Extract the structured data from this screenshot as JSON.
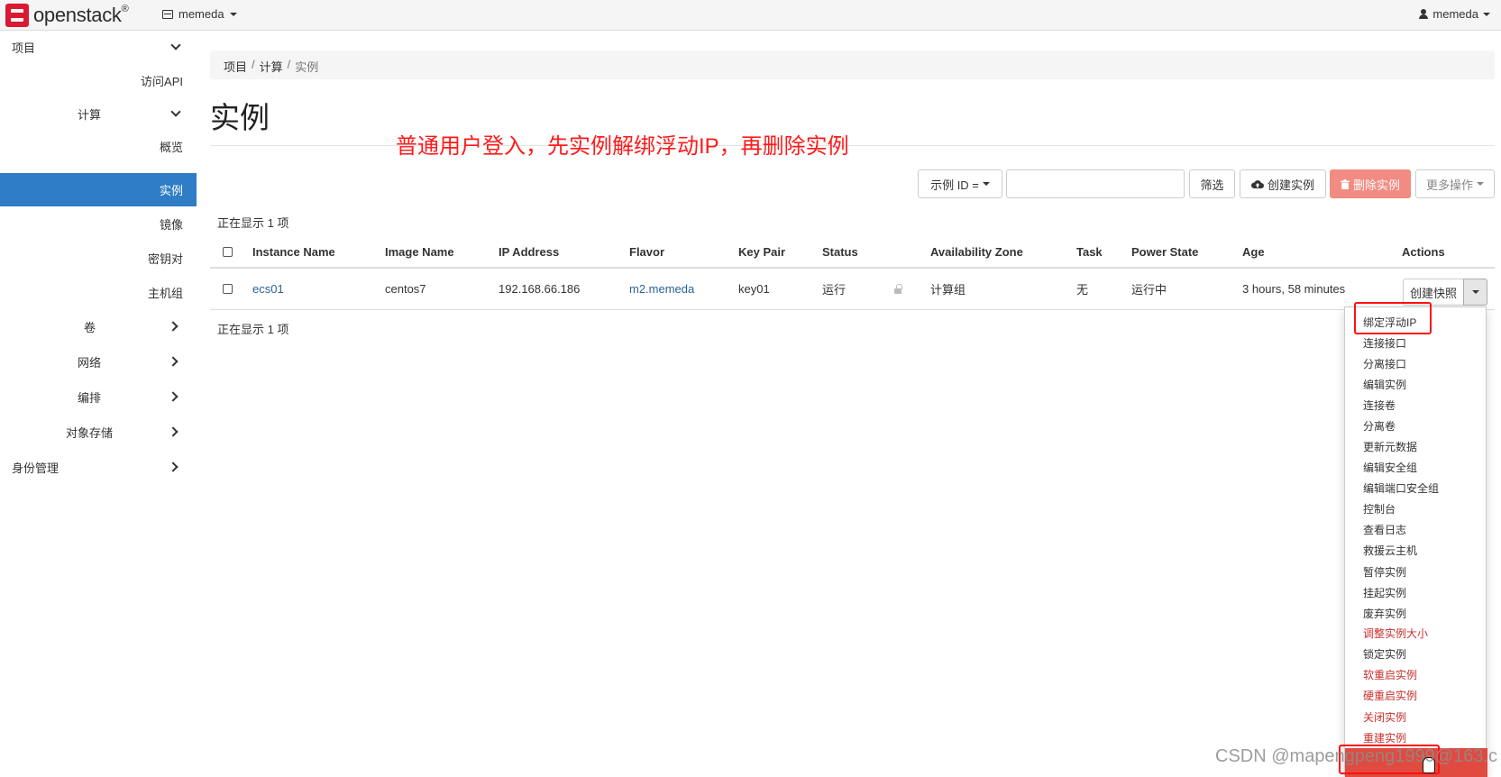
{
  "navbar": {
    "brand": "openstack",
    "brand_mark": "®",
    "project": "memeda",
    "user": "memeda"
  },
  "sidebar": {
    "items": [
      {
        "label": "项目"
      },
      {
        "label": "访问API"
      },
      {
        "label": "计算"
      },
      {
        "label": "概览"
      },
      {
        "label": "实例"
      },
      {
        "label": "镜像"
      },
      {
        "label": "密钥对"
      },
      {
        "label": "主机组"
      },
      {
        "label": "卷"
      },
      {
        "label": "网络"
      },
      {
        "label": "编排"
      },
      {
        "label": "对象存储"
      },
      {
        "label": "身份管理"
      }
    ]
  },
  "breadcrumb": {
    "items": [
      "项目",
      "计算",
      "实例"
    ]
  },
  "page": {
    "title": "实例",
    "annotation": "普通用户登入，先实例解绑浮动IP，再删除实例"
  },
  "toolbar": {
    "filter_select": "示例 ID =",
    "filter_value": "",
    "filter_button": "筛选",
    "create_button": "创建实例",
    "delete_button": "删除实例",
    "more_button": "更多操作"
  },
  "table": {
    "count_text": "正在显示 1 项",
    "headers": [
      "Instance Name",
      "Image Name",
      "IP Address",
      "Flavor",
      "Key Pair",
      "Status",
      "Availability Zone",
      "Task",
      "Power State",
      "Age",
      "Actions"
    ],
    "rows": [
      {
        "instance_name": "ecs01",
        "image_name": "centos7",
        "ip_address": "192.168.66.186",
        "flavor": "m2.memeda",
        "key_pair": "key01",
        "status": "运行",
        "availability_zone": "计算组",
        "task": "无",
        "power_state": "运行中",
        "age": "3 hours, 58 minutes",
        "action": "创建快照"
      }
    ]
  },
  "actions_menu": {
    "items": [
      {
        "label": "绑定浮动IP"
      },
      {
        "label": "连接接口"
      },
      {
        "label": "分离接口"
      },
      {
        "label": "编辑实例"
      },
      {
        "label": "连接卷"
      },
      {
        "label": "分离卷"
      },
      {
        "label": "更新元数据"
      },
      {
        "label": "编辑安全组"
      },
      {
        "label": "编辑端口安全组"
      },
      {
        "label": "控制台"
      },
      {
        "label": "查看日志"
      },
      {
        "label": "救援云主机"
      },
      {
        "label": "暂停实例"
      },
      {
        "label": "挂起实例"
      },
      {
        "label": "废弃实例"
      },
      {
        "label": "调整实例大小"
      },
      {
        "label": "锁定实例"
      },
      {
        "label": "软重启实例"
      },
      {
        "label": "硬重启实例"
      },
      {
        "label": "关闭实例"
      },
      {
        "label": "重建实例"
      }
    ]
  },
  "watermark": "CSDN @mapengpeng1999@163.c",
  "colors": {
    "accent": "#2f7dc6",
    "danger": "#f28b82",
    "annotation": "#ff1a1a",
    "link": "#2a6496"
  }
}
